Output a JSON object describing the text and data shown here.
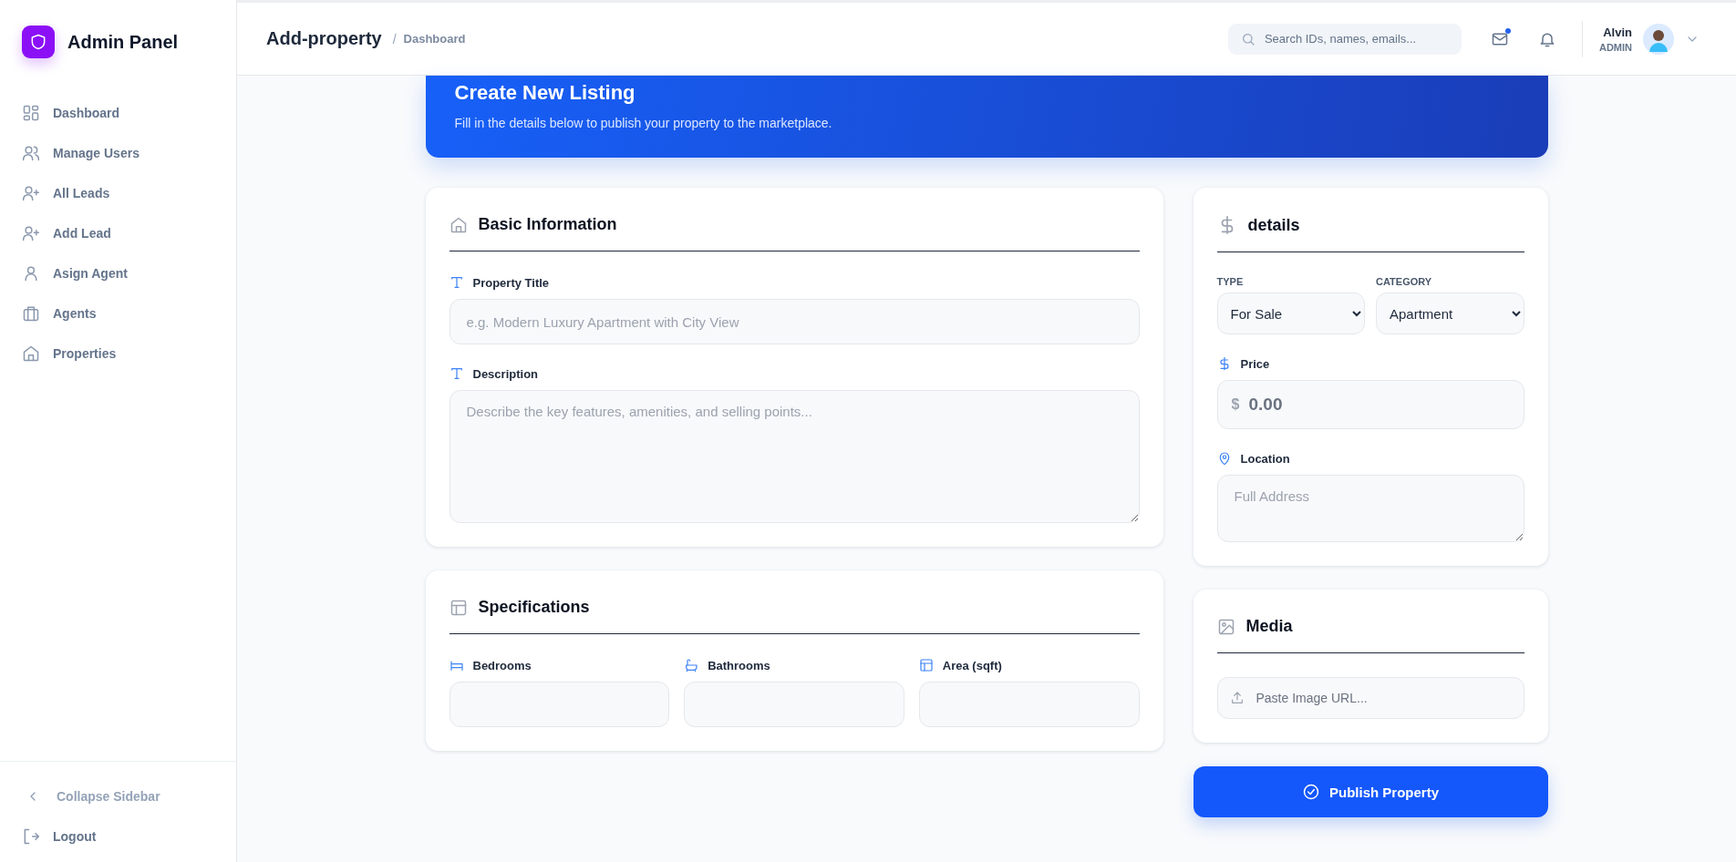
{
  "sidebar": {
    "brand": "Admin Panel",
    "items": [
      {
        "label": "Dashboard"
      },
      {
        "label": "Manage Users"
      },
      {
        "label": "All Leads"
      },
      {
        "label": "Add Lead"
      },
      {
        "label": "Asign Agent"
      },
      {
        "label": "Agents"
      },
      {
        "label": "Properties"
      }
    ],
    "footer": [
      {
        "label": "Collapse Sidebar"
      },
      {
        "label": "Logout"
      }
    ]
  },
  "header": {
    "title": "Add-property",
    "separator": "/",
    "breadcrumb": "Dashboard",
    "search": {
      "placeholder": "Search IDs, names, emails..."
    },
    "mail_unread": true,
    "user": {
      "name": "Alvin",
      "role": "ADMIN"
    }
  },
  "banner": {
    "title": "Create New Listing",
    "subtitle": "Fill in the details below to publish your property to the marketplace."
  },
  "basic_information": {
    "title": "Basic Information",
    "fields": [
      {
        "kind": "input",
        "label": "Property Title",
        "placeholder": "e.g. Modern Luxury Apartment with City View"
      },
      {
        "kind": "textarea",
        "label": "Description",
        "placeholder": "Describe the key features, amenities, and selling points..."
      }
    ]
  },
  "specifications": {
    "title": "Specifications",
    "fields": [
      {
        "label": "Bedrooms"
      },
      {
        "label": "Bathrooms"
      },
      {
        "label": "Area (sqft)"
      }
    ]
  },
  "details": {
    "title": "details",
    "selects": [
      {
        "label": "TYPE",
        "value": "For Sale"
      },
      {
        "label": "CATEGORY",
        "value": "Apartment"
      }
    ],
    "price": {
      "label": "Price",
      "prefix": "$",
      "placeholder": "0.00"
    },
    "location": {
      "label": "Location",
      "placeholder": "Full Address"
    }
  },
  "media": {
    "title": "Media",
    "placeholder": "Paste Image URL..."
  },
  "publish_button": "Publish Property"
}
